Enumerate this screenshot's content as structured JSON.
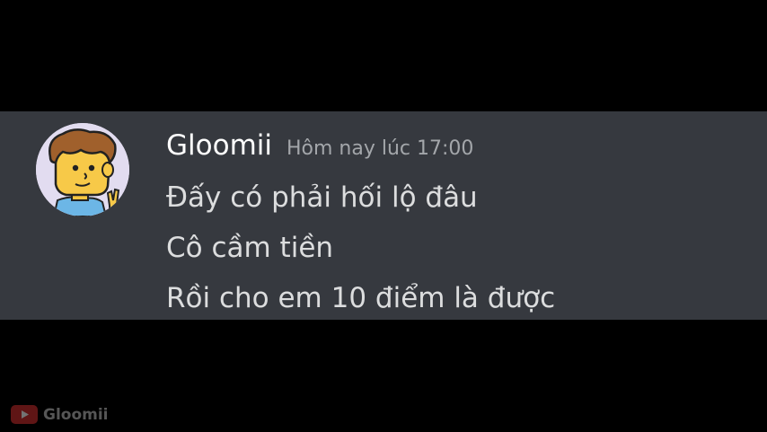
{
  "message": {
    "username": "Gloomii",
    "timestamp": "Hôm nay lúc 17:00",
    "lines": [
      "Đấy có phải hối lộ đâu",
      "Cô cầm tiền",
      "Rồi cho em 10 điểm là được"
    ]
  },
  "watermark": {
    "label": "Gloomii",
    "icon": "youtube-icon"
  },
  "avatar": {
    "icon": "cartoon-boy-avatar"
  },
  "colors": {
    "background": "#000000",
    "message_bg": "#36393f",
    "username": "#ffffff",
    "timestamp": "#a3a6aa",
    "text": "#dcddde"
  }
}
